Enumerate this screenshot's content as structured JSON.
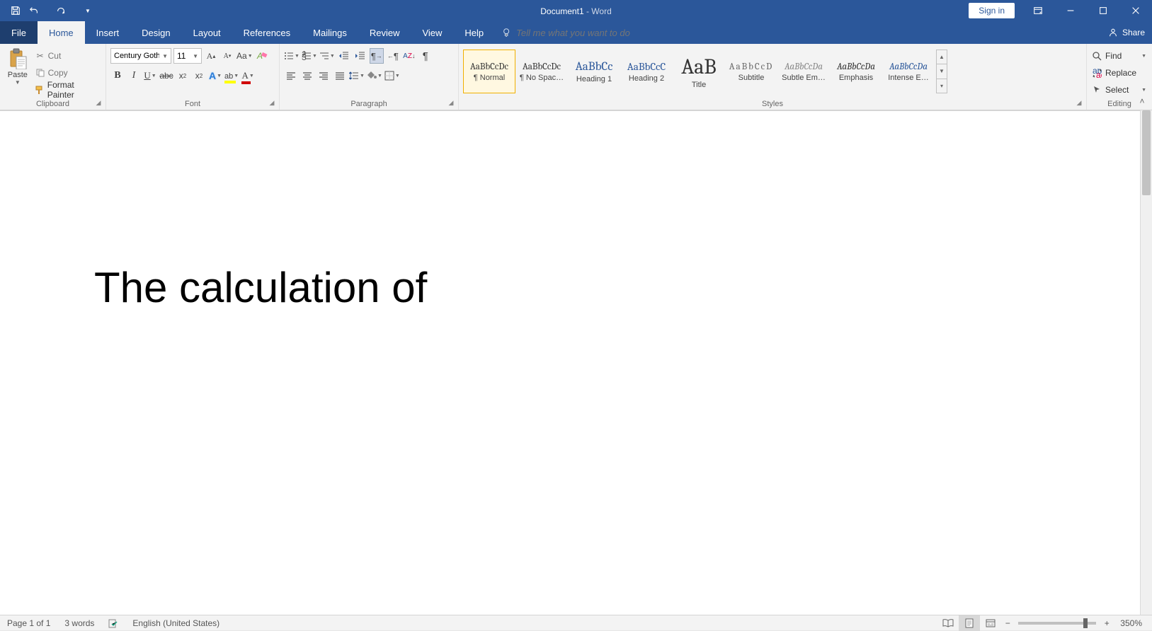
{
  "title": {
    "doc": "Document1",
    "sep": "  -  ",
    "app": "Word"
  },
  "qat": {
    "customize_tip": "▾"
  },
  "signin": "Sign in",
  "tabs": {
    "file": "File",
    "home": "Home",
    "insert": "Insert",
    "design": "Design",
    "layout": "Layout",
    "references": "References",
    "mailings": "Mailings",
    "review": "Review",
    "view": "View",
    "help": "Help"
  },
  "tellme_placeholder": "Tell me what you want to do",
  "share": "Share",
  "clipboard": {
    "paste": "Paste",
    "cut": "Cut",
    "copy": "Copy",
    "format_painter": "Format Painter",
    "label": "Clipboard"
  },
  "font": {
    "name": "Century Goth",
    "size": "11",
    "label": "Font"
  },
  "paragraph": {
    "label": "Paragraph"
  },
  "styles": {
    "label": "Styles",
    "items": [
      {
        "preview": "AaBbCcDc",
        "name": "¶ Normal",
        "cls": "sv-normal"
      },
      {
        "preview": "AaBbCcDc",
        "name": "¶ No Spac…",
        "cls": "sv-normal"
      },
      {
        "preview": "AaBbCc",
        "name": "Heading 1",
        "cls": "sv-h1"
      },
      {
        "preview": "AaBbCcC",
        "name": "Heading 2",
        "cls": "sv-h2"
      },
      {
        "preview": "AaB",
        "name": "Title",
        "cls": "sv-title"
      },
      {
        "preview": "AaBbCcD",
        "name": "Subtitle",
        "cls": "sv-sub"
      },
      {
        "preview": "AaBbCcDa",
        "name": "Subtle Em…",
        "cls": "sv-subem"
      },
      {
        "preview": "AaBbCcDa",
        "name": "Emphasis",
        "cls": "sv-emph"
      },
      {
        "preview": "AaBbCcDa",
        "name": "Intense E…",
        "cls": "sv-int"
      }
    ]
  },
  "editing": {
    "find": "Find",
    "replace": "Replace",
    "select": "Select",
    "label": "Editing"
  },
  "document": {
    "text": "The calculation of"
  },
  "status": {
    "page": "Page 1 of 1",
    "words": "3 words",
    "lang": "English (United States)",
    "zoom": "350%"
  }
}
